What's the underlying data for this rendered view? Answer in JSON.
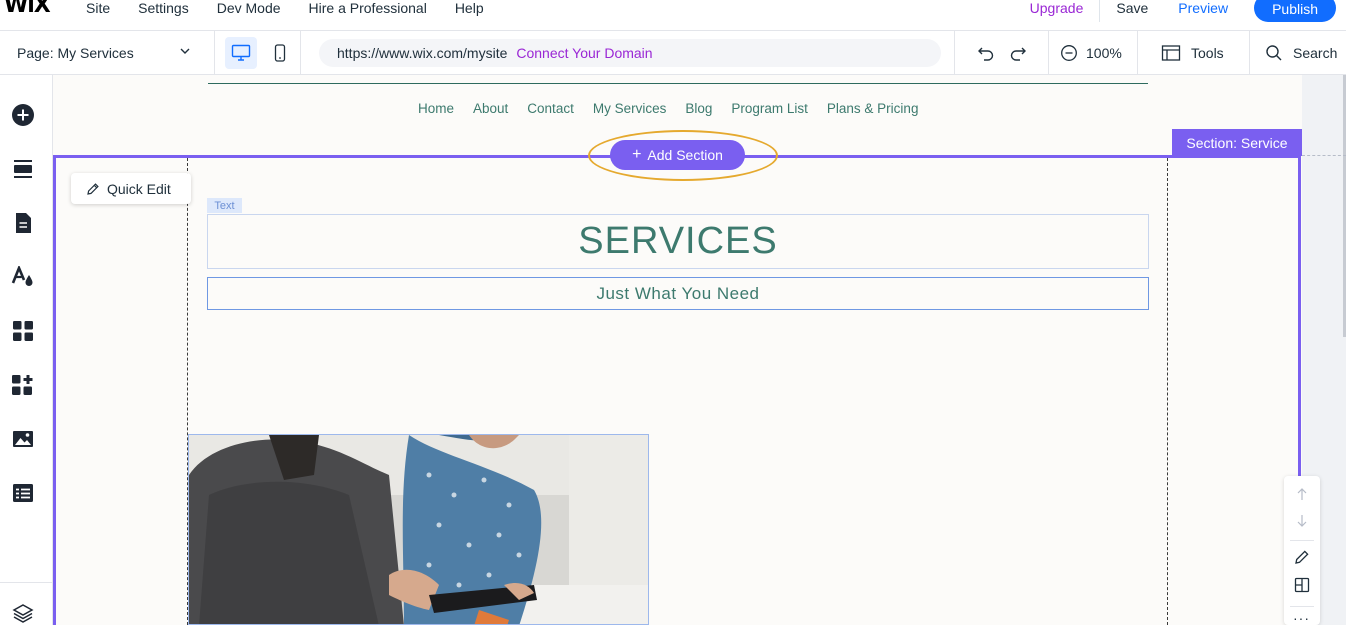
{
  "topbar": {
    "logo": "WiX",
    "menu": [
      "Site",
      "Settings",
      "Dev Mode",
      "Hire a Professional",
      "Help"
    ],
    "upgrade": "Upgrade",
    "save": "Save",
    "preview": "Preview",
    "publish": "Publish"
  },
  "toolbar": {
    "page_label": "Page: My Services",
    "url": "https://www.wix.com/mysite",
    "connect_domain": "Connect Your Domain",
    "zoom": "100%",
    "tools": "Tools",
    "search": "Search"
  },
  "left_rail": {
    "icons": [
      "add-icon",
      "sections-icon",
      "pages-icon",
      "design-icon",
      "apps-icon",
      "add-apps-icon",
      "media-icon",
      "cms-icon",
      "layers-icon"
    ]
  },
  "site": {
    "nav": [
      "Home",
      "About",
      "Contact",
      "My Services",
      "Blog",
      "Program List",
      "Plans & Pricing"
    ],
    "title": "SERVICES",
    "subtitle": "Just What You Need"
  },
  "editor": {
    "add_section": "Add Section",
    "section_label": "Section: Service",
    "quick_edit": "Quick Edit",
    "text_tag": "Text"
  },
  "colors": {
    "accent": "#116dff",
    "section_purple": "#7a5ff0",
    "upgrade_purple": "#9a27d5",
    "site_green": "#3d7a6e",
    "highlight_ring": "#e5a92e"
  }
}
